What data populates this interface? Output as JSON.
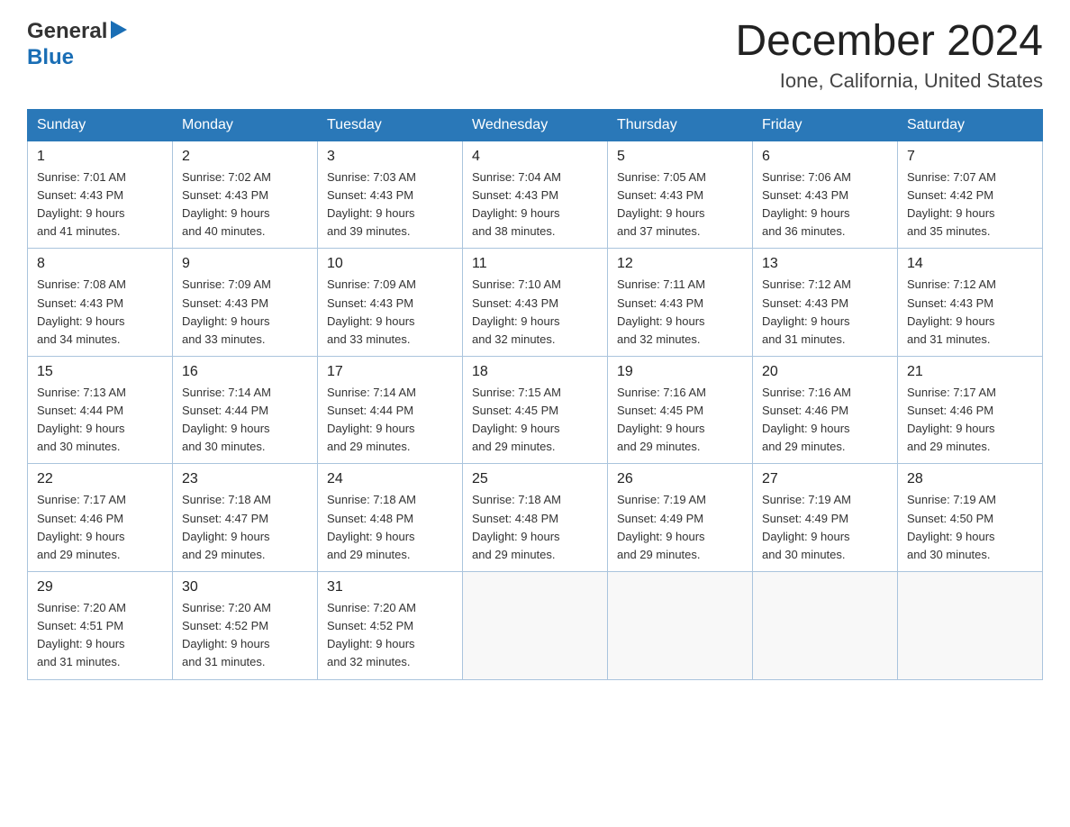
{
  "logo": {
    "line1": "General",
    "line2": "Blue",
    "arrow": "▶"
  },
  "title": "December 2024",
  "subtitle": "Ione, California, United States",
  "days_of_week": [
    "Sunday",
    "Monday",
    "Tuesday",
    "Wednesday",
    "Thursday",
    "Friday",
    "Saturday"
  ],
  "weeks": [
    [
      {
        "day": "1",
        "sunrise": "7:01 AM",
        "sunset": "4:43 PM",
        "daylight": "9 hours and 41 minutes."
      },
      {
        "day": "2",
        "sunrise": "7:02 AM",
        "sunset": "4:43 PM",
        "daylight": "9 hours and 40 minutes."
      },
      {
        "day": "3",
        "sunrise": "7:03 AM",
        "sunset": "4:43 PM",
        "daylight": "9 hours and 39 minutes."
      },
      {
        "day": "4",
        "sunrise": "7:04 AM",
        "sunset": "4:43 PM",
        "daylight": "9 hours and 38 minutes."
      },
      {
        "day": "5",
        "sunrise": "7:05 AM",
        "sunset": "4:43 PM",
        "daylight": "9 hours and 37 minutes."
      },
      {
        "day": "6",
        "sunrise": "7:06 AM",
        "sunset": "4:43 PM",
        "daylight": "9 hours and 36 minutes."
      },
      {
        "day": "7",
        "sunrise": "7:07 AM",
        "sunset": "4:42 PM",
        "daylight": "9 hours and 35 minutes."
      }
    ],
    [
      {
        "day": "8",
        "sunrise": "7:08 AM",
        "sunset": "4:43 PM",
        "daylight": "9 hours and 34 minutes."
      },
      {
        "day": "9",
        "sunrise": "7:09 AM",
        "sunset": "4:43 PM",
        "daylight": "9 hours and 33 minutes."
      },
      {
        "day": "10",
        "sunrise": "7:09 AM",
        "sunset": "4:43 PM",
        "daylight": "9 hours and 33 minutes."
      },
      {
        "day": "11",
        "sunrise": "7:10 AM",
        "sunset": "4:43 PM",
        "daylight": "9 hours and 32 minutes."
      },
      {
        "day": "12",
        "sunrise": "7:11 AM",
        "sunset": "4:43 PM",
        "daylight": "9 hours and 32 minutes."
      },
      {
        "day": "13",
        "sunrise": "7:12 AM",
        "sunset": "4:43 PM",
        "daylight": "9 hours and 31 minutes."
      },
      {
        "day": "14",
        "sunrise": "7:12 AM",
        "sunset": "4:43 PM",
        "daylight": "9 hours and 31 minutes."
      }
    ],
    [
      {
        "day": "15",
        "sunrise": "7:13 AM",
        "sunset": "4:44 PM",
        "daylight": "9 hours and 30 minutes."
      },
      {
        "day": "16",
        "sunrise": "7:14 AM",
        "sunset": "4:44 PM",
        "daylight": "9 hours and 30 minutes."
      },
      {
        "day": "17",
        "sunrise": "7:14 AM",
        "sunset": "4:44 PM",
        "daylight": "9 hours and 29 minutes."
      },
      {
        "day": "18",
        "sunrise": "7:15 AM",
        "sunset": "4:45 PM",
        "daylight": "9 hours and 29 minutes."
      },
      {
        "day": "19",
        "sunrise": "7:16 AM",
        "sunset": "4:45 PM",
        "daylight": "9 hours and 29 minutes."
      },
      {
        "day": "20",
        "sunrise": "7:16 AM",
        "sunset": "4:46 PM",
        "daylight": "9 hours and 29 minutes."
      },
      {
        "day": "21",
        "sunrise": "7:17 AM",
        "sunset": "4:46 PM",
        "daylight": "9 hours and 29 minutes."
      }
    ],
    [
      {
        "day": "22",
        "sunrise": "7:17 AM",
        "sunset": "4:46 PM",
        "daylight": "9 hours and 29 minutes."
      },
      {
        "day": "23",
        "sunrise": "7:18 AM",
        "sunset": "4:47 PM",
        "daylight": "9 hours and 29 minutes."
      },
      {
        "day": "24",
        "sunrise": "7:18 AM",
        "sunset": "4:48 PM",
        "daylight": "9 hours and 29 minutes."
      },
      {
        "day": "25",
        "sunrise": "7:18 AM",
        "sunset": "4:48 PM",
        "daylight": "9 hours and 29 minutes."
      },
      {
        "day": "26",
        "sunrise": "7:19 AM",
        "sunset": "4:49 PM",
        "daylight": "9 hours and 29 minutes."
      },
      {
        "day": "27",
        "sunrise": "7:19 AM",
        "sunset": "4:49 PM",
        "daylight": "9 hours and 30 minutes."
      },
      {
        "day": "28",
        "sunrise": "7:19 AM",
        "sunset": "4:50 PM",
        "daylight": "9 hours and 30 minutes."
      }
    ],
    [
      {
        "day": "29",
        "sunrise": "7:20 AM",
        "sunset": "4:51 PM",
        "daylight": "9 hours and 31 minutes."
      },
      {
        "day": "30",
        "sunrise": "7:20 AM",
        "sunset": "4:52 PM",
        "daylight": "9 hours and 31 minutes."
      },
      {
        "day": "31",
        "sunrise": "7:20 AM",
        "sunset": "4:52 PM",
        "daylight": "9 hours and 32 minutes."
      },
      null,
      null,
      null,
      null
    ]
  ]
}
